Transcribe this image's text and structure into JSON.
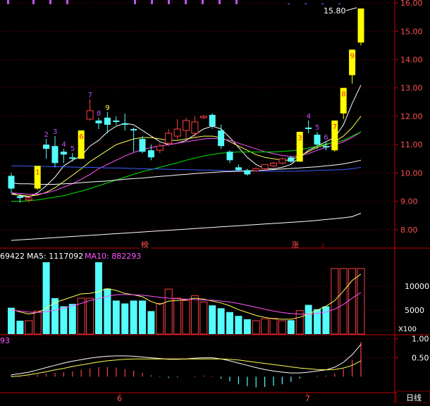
{
  "colors": {
    "background": "#000000",
    "up": "#ff4040",
    "down": "#54fcfc",
    "limit_up": "#ffff00",
    "axis": "#c00000",
    "grid": "#800000",
    "ma_white": "#ffffff",
    "ma_yellow": "#ffff54",
    "ma_magenta": "#ff54ff",
    "ma_green": "#00e600",
    "ma_blue": "#3c5aff",
    "marker": "#c050ff",
    "label_red": "#ff5050"
  },
  "price_panel": {
    "high_label": "15.80",
    "markers": [
      "榜",
      "涨"
    ]
  },
  "volume_panel": {
    "legend_vol": "69422",
    "legend_ma5": "MA5: 1117092",
    "legend_ma10": "MA10: 882293",
    "multiplier": "X100"
  },
  "macd_panel": {
    "legend": "93"
  },
  "x_axis": {
    "labels": [
      "6",
      "7"
    ],
    "period_button": "日线"
  },
  "chart_data": [
    {
      "type": "candlestick",
      "y_ticks": [
        "16.00",
        "15.00",
        "14.00",
        "13.00",
        "12.00",
        "11.00",
        "10.00",
        "9.00",
        "8.00"
      ],
      "ylim": [
        7.4,
        16.1
      ],
      "candles": [
        {
          "o": 9.9,
          "c": 9.45,
          "h": 10.0,
          "l": 9.3
        },
        {
          "o": 9.18,
          "c": 9.12,
          "h": 9.25,
          "l": 8.95
        },
        {
          "o": 9.05,
          "c": 9.12,
          "h": 9.22,
          "l": 8.95
        },
        {
          "o": 9.45,
          "c": 10.25,
          "h": 10.25,
          "l": 9.4,
          "limit": true,
          "n": "1"
        },
        {
          "o": 11.0,
          "c": 10.85,
          "h": 11.2,
          "l": 10.5,
          "n": "2"
        },
        {
          "o": 10.95,
          "c": 10.35,
          "h": 11.3,
          "l": 10.2,
          "n": "3"
        },
        {
          "o": 10.75,
          "c": 10.65,
          "h": 10.85,
          "l": 10.35,
          "n": "4"
        },
        {
          "o": 10.55,
          "c": 10.5,
          "h": 10.7,
          "l": 10.4,
          "n": "5"
        },
        {
          "o": 10.5,
          "c": 11.5,
          "h": 11.5,
          "l": 10.5,
          "limit": true,
          "n": "6"
        },
        {
          "o": 11.9,
          "c": 12.2,
          "h": 12.6,
          "l": 11.85,
          "n": "7"
        },
        {
          "o": 11.85,
          "c": 11.75,
          "h": 11.95,
          "l": 11.55,
          "n": "8"
        },
        {
          "o": 11.95,
          "c": 11.7,
          "h": 12.15,
          "l": 11.4,
          "n": "9"
        },
        {
          "o": 11.85,
          "c": 11.8,
          "h": 12.0,
          "l": 11.7
        },
        {
          "o": 11.75,
          "c": 11.7,
          "h": 12.1,
          "l": 11.5
        },
        {
          "o": 11.55,
          "c": 11.5,
          "h": 11.6,
          "l": 10.75
        },
        {
          "o": 11.2,
          "c": 10.75,
          "h": 11.3,
          "l": 10.7
        },
        {
          "o": 10.8,
          "c": 10.55,
          "h": 11.0,
          "l": 10.45
        },
        {
          "o": 10.8,
          "c": 10.95,
          "h": 11.05,
          "l": 10.7
        },
        {
          "o": 11.05,
          "c": 11.4,
          "h": 11.55,
          "l": 10.95
        },
        {
          "o": 11.3,
          "c": 11.55,
          "h": 11.9,
          "l": 11.2
        },
        {
          "o": 11.5,
          "c": 11.85,
          "h": 11.95,
          "l": 11.2
        },
        {
          "o": 11.4,
          "c": 11.8,
          "h": 12.0,
          "l": 11.25
        },
        {
          "o": 11.95,
          "c": 12.0,
          "h": 12.05,
          "l": 11.9
        },
        {
          "o": 12.05,
          "c": 11.65,
          "h": 12.1,
          "l": 11.55
        },
        {
          "o": 11.5,
          "c": 10.95,
          "h": 11.7,
          "l": 10.85
        },
        {
          "o": 10.75,
          "c": 10.45,
          "h": 10.8,
          "l": 10.35
        },
        {
          "o": 10.2,
          "c": 10.1,
          "h": 10.3,
          "l": 10.05
        },
        {
          "o": 10.1,
          "c": 9.95,
          "h": 10.15,
          "l": 9.9
        },
        {
          "o": 10.08,
          "c": 10.15,
          "h": 10.2,
          "l": 10.05
        },
        {
          "o": 10.15,
          "c": 10.3,
          "h": 10.3,
          "l": 10.1
        },
        {
          "o": 10.25,
          "c": 10.35,
          "h": 10.4,
          "l": 10.2
        },
        {
          "o": 10.35,
          "c": 10.5,
          "h": 10.55,
          "l": 10.3
        },
        {
          "o": 10.55,
          "c": 10.4,
          "h": 10.6,
          "l": 10.35
        },
        {
          "o": 10.4,
          "c": 11.45,
          "h": 11.45,
          "l": 10.4,
          "limit": true,
          "n": "3"
        },
        {
          "o": 11.6,
          "c": 11.55,
          "h": 11.85,
          "l": 11.4,
          "n": "4"
        },
        {
          "o": 11.35,
          "c": 11.0,
          "h": 11.45,
          "l": 10.85,
          "n": "5"
        },
        {
          "o": 10.95,
          "c": 10.9,
          "h": 11.1,
          "l": 10.8,
          "n": "6"
        },
        {
          "o": 10.8,
          "c": 11.85,
          "h": 11.85,
          "l": 10.75,
          "limit": true,
          "n": "7"
        },
        {
          "o": 12.1,
          "c": 13.0,
          "h": 13.0,
          "l": 11.9,
          "limit": true,
          "n": "8"
        },
        {
          "o": 13.45,
          "c": 14.35,
          "h": 14.35,
          "l": 13.15,
          "limit": true,
          "n": "9"
        },
        {
          "o": 14.6,
          "c": 15.8,
          "h": 15.8,
          "l": 14.5,
          "limit": true
        }
      ],
      "ma_lines": [
        {
          "key": "white_short",
          "color": "#ffffff",
          "values": [
            9.3,
            9.2,
            9.15,
            9.3,
            9.55,
            9.85,
            10.25,
            10.45,
            10.6,
            10.95,
            11.15,
            11.45,
            11.65,
            11.75,
            11.7,
            11.5,
            11.3,
            11.1,
            11.0,
            11.05,
            11.15,
            11.35,
            11.55,
            11.65,
            11.55,
            11.25,
            10.9,
            10.55,
            10.3,
            10.15,
            10.15,
            10.2,
            10.3,
            10.55,
            10.8,
            10.95,
            11.1,
            11.25,
            11.7,
            12.45,
            13.1
          ]
        },
        {
          "key": "yellow",
          "color": "#ffff54",
          "values": [
            9.25,
            9.22,
            9.18,
            9.22,
            9.32,
            9.48,
            9.7,
            9.92,
            10.15,
            10.4,
            10.6,
            10.8,
            11.0,
            11.1,
            11.2,
            11.25,
            11.25,
            11.2,
            11.15,
            11.15,
            11.2,
            11.25,
            11.3,
            11.3,
            11.25,
            11.1,
            10.95,
            10.8,
            10.65,
            10.55,
            10.5,
            10.45,
            10.45,
            10.6,
            10.75,
            10.9,
            11.0,
            11.1,
            11.3,
            11.6,
            12.0
          ]
        },
        {
          "key": "magenta",
          "color": "#ff54ff",
          "values": [
            9.3,
            9.28,
            9.25,
            9.25,
            9.3,
            9.38,
            9.5,
            9.62,
            9.78,
            9.95,
            10.15,
            10.3,
            10.45,
            10.6,
            10.72,
            10.82,
            10.9,
            10.95,
            11.0,
            11.05,
            11.1,
            11.15,
            11.2,
            11.22,
            11.2,
            11.15,
            11.05,
            10.95,
            10.85,
            10.75,
            10.68,
            10.62,
            10.58,
            10.6,
            10.68,
            10.8,
            10.9,
            11.0,
            11.1,
            11.25,
            11.45
          ]
        },
        {
          "key": "green",
          "color": "#00e600",
          "values": [
            9.0,
            9.0,
            9.02,
            9.05,
            9.1,
            9.15,
            9.2,
            9.28,
            9.36,
            9.45,
            9.55,
            9.65,
            9.75,
            9.85,
            9.95,
            10.05,
            10.12,
            10.2,
            10.28,
            10.36,
            10.45,
            10.52,
            10.6,
            10.65,
            10.7,
            10.72,
            10.74,
            10.74,
            10.74,
            10.74,
            10.74,
            10.76,
            10.78,
            10.82,
            10.88,
            10.95,
            11.02,
            11.08,
            11.15,
            11.3,
            11.45
          ]
        },
        {
          "key": "blue",
          "color": "#3c5aff",
          "values": [
            10.25,
            10.25,
            10.24,
            10.24,
            10.23,
            10.22,
            10.22,
            10.21,
            10.2,
            10.2,
            10.19,
            10.18,
            10.18,
            10.17,
            10.16,
            10.15,
            10.14,
            10.14,
            10.13,
            10.12,
            10.12,
            10.11,
            10.1,
            10.1,
            10.09,
            10.08,
            10.08,
            10.07,
            10.07,
            10.06,
            10.06,
            10.06,
            10.06,
            10.07,
            10.08,
            10.09,
            10.1,
            10.11,
            10.12,
            10.15,
            10.2
          ]
        },
        {
          "key": "white_lower",
          "color": "#ffffff",
          "values": [
            9.65,
            9.62,
            9.62,
            9.6,
            9.6,
            9.6,
            9.62,
            9.63,
            9.66,
            9.68,
            9.7,
            9.72,
            9.75,
            9.78,
            9.8,
            9.82,
            9.85,
            9.88,
            9.9,
            9.93,
            9.95,
            9.98,
            10.0,
            10.02,
            10.04,
            10.05,
            10.06,
            10.07,
            10.08,
            10.1,
            10.12,
            10.14,
            10.16,
            10.18,
            10.2,
            10.22,
            10.25,
            10.28,
            10.32,
            10.38,
            10.45
          ]
        },
        {
          "key": "white_long",
          "color": "#ffffff",
          "values": [
            7.62,
            7.64,
            7.66,
            7.68,
            7.7,
            7.72,
            7.74,
            7.76,
            7.78,
            7.8,
            7.82,
            7.84,
            7.86,
            7.88,
            7.9,
            7.92,
            7.94,
            7.96,
            7.98,
            8.0,
            8.02,
            8.04,
            8.06,
            8.08,
            8.1,
            8.12,
            8.14,
            8.16,
            8.18,
            8.2,
            8.22,
            8.24,
            8.26,
            8.28,
            8.3,
            8.33,
            8.36,
            8.39,
            8.42,
            8.46,
            8.58
          ]
        }
      ]
    },
    {
      "type": "bar",
      "y_ticks": [
        "10000",
        "5000"
      ],
      "ylim": [
        0,
        15300
      ],
      "values": [
        5500,
        2800,
        2800,
        4800,
        15000,
        7500,
        5800,
        6300,
        7500,
        7500,
        15000,
        9500,
        7000,
        6400,
        7000,
        7000,
        4800,
        6400,
        9400,
        7500,
        7000,
        8000,
        6700,
        6000,
        5400,
        4600,
        3800,
        3100,
        2800,
        3200,
        3300,
        2800,
        2900,
        4900,
        6100,
        5200,
        5800,
        13700,
        13700,
        13700,
        13700
      ],
      "ma_lines": [
        {
          "key": "ma5",
          "color": "#ffff54",
          "values": [
            5200,
            4600,
            4200,
            4500,
            5400,
            6600,
            7200,
            7800,
            8400,
            8500,
            8900,
            9500,
            9100,
            8500,
            8200,
            7800,
            6800,
            6200,
            6900,
            7000,
            7200,
            7500,
            7300,
            6900,
            6500,
            5900,
            5100,
            4500,
            3900,
            3500,
            3200,
            3100,
            3100,
            3500,
            4200,
            5000,
            5800,
            7000,
            9000,
            11200,
            12500
          ]
        },
        {
          "key": "ma10",
          "color": "#ff54ff",
          "values": [
            5000,
            4800,
            4600,
            4500,
            4700,
            5000,
            5400,
            5900,
            6400,
            7000,
            7400,
            7900,
            8200,
            8300,
            8200,
            8100,
            7900,
            7700,
            7500,
            7400,
            7300,
            7200,
            7100,
            7100,
            6900,
            6700,
            6400,
            6000,
            5600,
            5200,
            4800,
            4500,
            4300,
            4200,
            4200,
            4300,
            4600,
            5200,
            6200,
            7500,
            8700
          ]
        }
      ]
    },
    {
      "type": "bar",
      "y_ticks": [
        "1.00",
        "0.50"
      ],
      "ylim": [
        -0.42,
        1.05
      ],
      "values": [
        0.05,
        0.03,
        0.02,
        0.05,
        0.08,
        0.1,
        0.12,
        0.14,
        0.18,
        0.22,
        0.25,
        0.26,
        0.24,
        0.2,
        0.16,
        0.1,
        0.04,
        -0.01,
        -0.03,
        -0.02,
        0.0,
        0.02,
        0.03,
        0.02,
        -0.05,
        -0.12,
        -0.2,
        -0.25,
        -0.28,
        -0.27,
        -0.24,
        -0.2,
        -0.14,
        -0.05,
        0.0,
        0.02,
        0.03,
        0.08,
        0.2,
        0.45,
        0.92
      ],
      "ma_lines": [
        {
          "key": "dif",
          "color": "#ffffff",
          "values": [
            0.05,
            0.08,
            0.12,
            0.18,
            0.24,
            0.3,
            0.36,
            0.41,
            0.45,
            0.49,
            0.52,
            0.54,
            0.55,
            0.55,
            0.54,
            0.52,
            0.5,
            0.48,
            0.46,
            0.46,
            0.47,
            0.49,
            0.5,
            0.5,
            0.47,
            0.42,
            0.36,
            0.3,
            0.24,
            0.19,
            0.15,
            0.12,
            0.1,
            0.1,
            0.12,
            0.15,
            0.18,
            0.25,
            0.38,
            0.58,
            0.85
          ]
        },
        {
          "key": "dea",
          "color": "#ffff54",
          "values": [
            0.0,
            0.02,
            0.05,
            0.09,
            0.13,
            0.18,
            0.22,
            0.27,
            0.31,
            0.35,
            0.39,
            0.42,
            0.44,
            0.46,
            0.47,
            0.47,
            0.47,
            0.47,
            0.47,
            0.47,
            0.47,
            0.47,
            0.47,
            0.47,
            0.47,
            0.46,
            0.44,
            0.41,
            0.38,
            0.35,
            0.32,
            0.29,
            0.26,
            0.23,
            0.21,
            0.19,
            0.18,
            0.19,
            0.23,
            0.3,
            0.42
          ]
        }
      ]
    }
  ]
}
